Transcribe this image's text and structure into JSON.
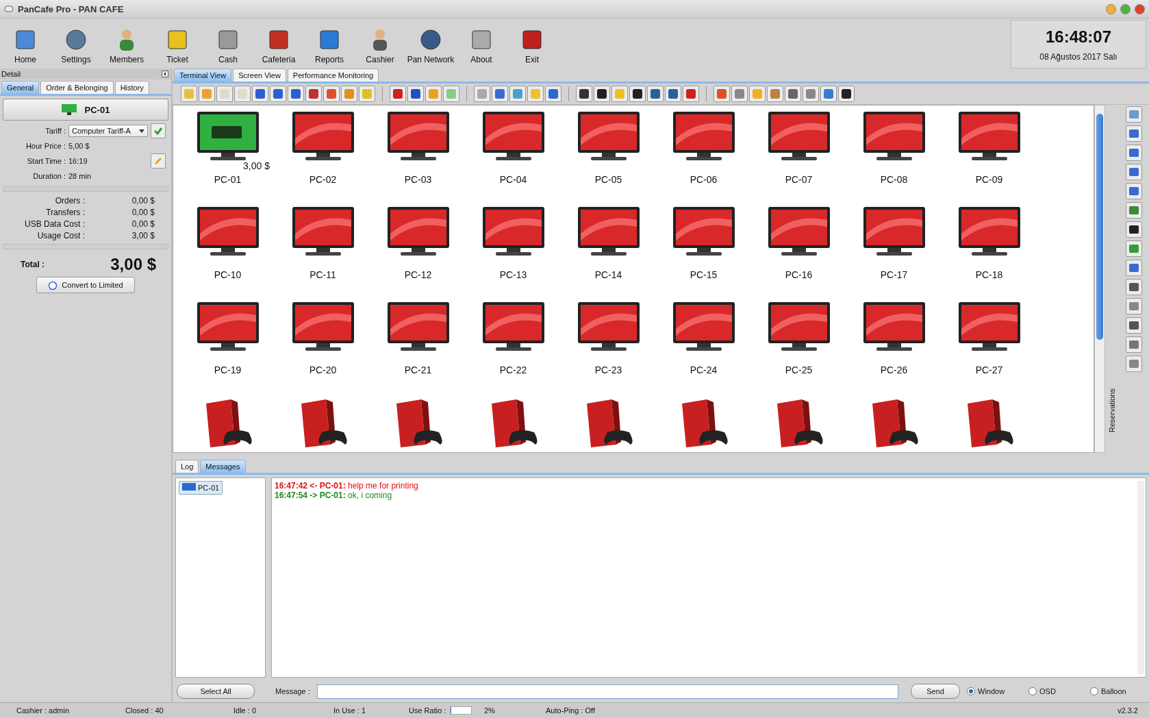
{
  "window": {
    "title": "PanCafe Pro - PAN CAFE"
  },
  "toolbar": [
    "Home",
    "Settings",
    "Members",
    "Ticket",
    "Cash",
    "Cafeteria",
    "Reports",
    "Cashier",
    "Pan Network",
    "About",
    "Exit"
  ],
  "clock": {
    "time": "16:48:07",
    "date": "08 Ağustos 2017 Salı"
  },
  "detail": {
    "title": "Detail",
    "tabs": [
      {
        "label": "General",
        "selected": true
      },
      {
        "label": "Order & Belonging",
        "selected": false
      },
      {
        "label": "History",
        "selected": false
      }
    ],
    "terminal": "PC-01",
    "fields": [
      {
        "label": "Tariff :",
        "value": "Computer Tariff-A",
        "kind": "select"
      },
      {
        "label": "Hour Price :",
        "value": "5,00 $",
        "kind": "text"
      },
      {
        "label": "Start Time :",
        "value": "16:19",
        "kind": "edit"
      },
      {
        "label": "Duration :",
        "value": "28 min",
        "kind": "text"
      }
    ],
    "costs": [
      {
        "label": "Orders :",
        "value": "0,00 $"
      },
      {
        "label": "Transfers :",
        "value": "0,00 $"
      },
      {
        "label": "USB Data Cost :",
        "value": "0,00 $"
      },
      {
        "label": "Usage Cost :",
        "value": "3,00 $"
      }
    ],
    "total_label": "Total :",
    "total": "3,00 $",
    "button": "Convert to Limited"
  },
  "views": [
    {
      "label": "Terminal View",
      "selected": true
    },
    {
      "label": "Screen View",
      "selected": false
    },
    {
      "label": "Performance Monitoring",
      "selected": false
    }
  ],
  "terminals": [
    {
      "kind": "pc",
      "label": "PC-01",
      "active": true,
      "amount": "3,00 $"
    },
    {
      "kind": "pc",
      "label": "PC-02",
      "active": false
    },
    {
      "kind": "pc",
      "label": "PC-03",
      "active": false
    },
    {
      "kind": "pc",
      "label": "PC-04",
      "active": false
    },
    {
      "kind": "pc",
      "label": "PC-05",
      "active": false
    },
    {
      "kind": "pc",
      "label": "PC-06",
      "active": false
    },
    {
      "kind": "pc",
      "label": "PC-07",
      "active": false
    },
    {
      "kind": "pc",
      "label": "PC-08",
      "active": false
    },
    {
      "kind": "pc",
      "label": "PC-09",
      "active": false
    },
    {
      "kind": "pc",
      "label": "PC-10",
      "active": false
    },
    {
      "kind": "pc",
      "label": "PC-11",
      "active": false
    },
    {
      "kind": "pc",
      "label": "PC-12",
      "active": false
    },
    {
      "kind": "pc",
      "label": "PC-13",
      "active": false
    },
    {
      "kind": "pc",
      "label": "PC-14",
      "active": false
    },
    {
      "kind": "pc",
      "label": "PC-15",
      "active": false
    },
    {
      "kind": "pc",
      "label": "PC-16",
      "active": false
    },
    {
      "kind": "pc",
      "label": "PC-17",
      "active": false
    },
    {
      "kind": "pc",
      "label": "PC-18",
      "active": false
    },
    {
      "kind": "pc",
      "label": "PC-19",
      "active": false
    },
    {
      "kind": "pc",
      "label": "PC-20",
      "active": false
    },
    {
      "kind": "pc",
      "label": "PC-21",
      "active": false
    },
    {
      "kind": "pc",
      "label": "PC-22",
      "active": false
    },
    {
      "kind": "pc",
      "label": "PC-23",
      "active": false
    },
    {
      "kind": "pc",
      "label": "PC-24",
      "active": false
    },
    {
      "kind": "pc",
      "label": "PC-25",
      "active": false
    },
    {
      "kind": "pc",
      "label": "PC-26",
      "active": false
    },
    {
      "kind": "pc",
      "label": "PC-27",
      "active": false
    },
    {
      "kind": "console"
    },
    {
      "kind": "console"
    },
    {
      "kind": "console"
    },
    {
      "kind": "console"
    },
    {
      "kind": "console"
    },
    {
      "kind": "console"
    },
    {
      "kind": "console"
    },
    {
      "kind": "console"
    },
    {
      "kind": "console"
    }
  ],
  "reservations_label": "Reservations",
  "bottom_tabs": [
    {
      "label": "Log",
      "selected": false
    },
    {
      "label": "Messages",
      "selected": true
    }
  ],
  "recipients": [
    {
      "label": "PC-01",
      "selected": true
    }
  ],
  "messages": [
    {
      "kind": "incoming",
      "head": "16:47:42 <- PC-01:",
      "text": "help me for printing"
    },
    {
      "kind": "outgoing",
      "head": "16:47:54 -> PC-01:",
      "text": "ok, i coming"
    }
  ],
  "select_all": "Select All",
  "message_label": "Message :",
  "send": "Send",
  "modes": [
    {
      "label": "Window",
      "selected": true
    },
    {
      "label": "OSD",
      "selected": false
    },
    {
      "label": "Balloon",
      "selected": false
    }
  ],
  "status": {
    "cashier": "Cashier : admin",
    "closed": "Closed : 40",
    "idle": "Idle : 0",
    "in_use": "In Use : 1",
    "ratio_label": "Use Ratio :",
    "level": 0.02,
    "ratio": "2%",
    "autoping": "Auto-Ping : Off",
    "version": "v2.3.2"
  }
}
